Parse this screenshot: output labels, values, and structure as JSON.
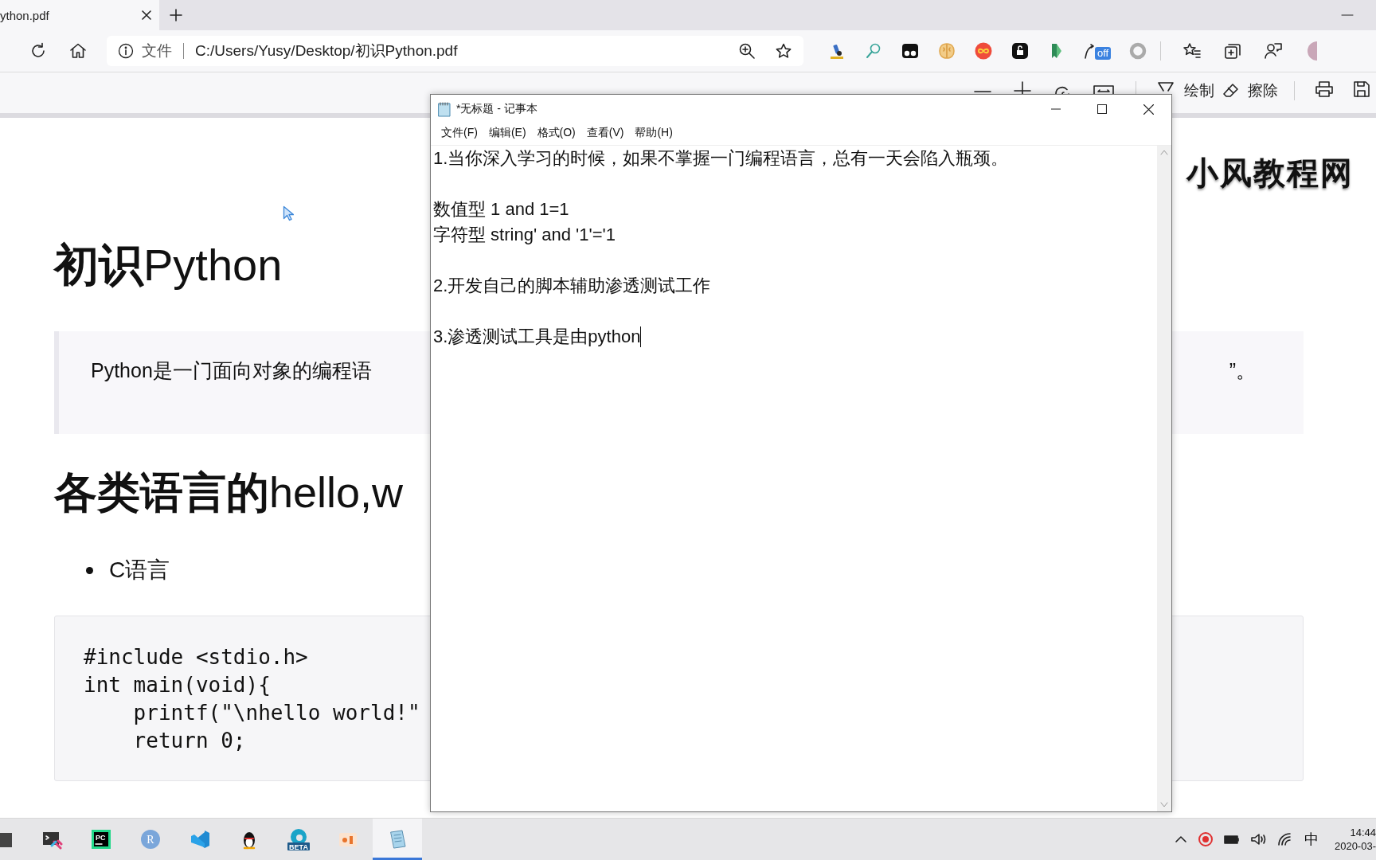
{
  "browser": {
    "tab": {
      "title": "ython.pdf",
      "selected": true
    },
    "address": {
      "label": "文件",
      "url": "C:/Users/Yusy/Desktop/初识Python.pdf"
    },
    "extensions": [
      {
        "kind": "microscope"
      },
      {
        "kind": "magnifier"
      },
      {
        "kind": "eyes"
      },
      {
        "kind": "brain"
      },
      {
        "kind": "infinity"
      },
      {
        "kind": "lock"
      },
      {
        "kind": "bookmark"
      },
      {
        "kind": "translate",
        "badge": "off"
      },
      {
        "kind": "ring"
      }
    ]
  },
  "pdf_toolbar": {
    "draw": "绘制",
    "erase": "擦除"
  },
  "document": {
    "logo": "小风教程网",
    "title": "**初识**Python",
    "quote_left": "Python是一门面向对象的编程语",
    "quote_right": "”。",
    "heading": "**各类语言的**hello,w",
    "bullet": "C语言",
    "code": [
      "#include <stdio.h>",
      "int main(void){",
      "    printf(\"\\nhello world!\"",
      "    return 0;"
    ]
  },
  "notepad": {
    "title": "*无标题 - 记事本",
    "menu": [
      "文件(F)",
      "编辑(E)",
      "格式(O)",
      "查看(V)",
      "帮助(H)"
    ],
    "paragraphs": [
      [
        "1.当你深入学习的时候，如果不掌握一门编程语言，总有一天会陷入瓶颈。"
      ],
      [
        "数值型 1 and 1=1",
        "字符型 string' and '1'='1"
      ],
      [
        "2.开发自己的脚本辅助渗透测试工作"
      ],
      [
        "3.渗透测试工具是由python"
      ]
    ]
  },
  "taskbar": {
    "apps": [
      {
        "kind": "file",
        "selected": false
      },
      {
        "kind": "terminal",
        "selected": false
      },
      {
        "kind": "letter-tile",
        "label": "PC",
        "selected": false
      },
      {
        "kind": "letter-circle",
        "label": "R",
        "selected": false
      },
      {
        "kind": "code-editor",
        "selected": false
      },
      {
        "kind": "penguin",
        "selected": false
      },
      {
        "kind": "browser-beta",
        "label": "BETA",
        "selected": false
      },
      {
        "kind": "slides",
        "selected": false
      },
      {
        "kind": "notepad",
        "selected": true
      }
    ],
    "ime": "中",
    "time": "14:44",
    "date": "2020-03-"
  }
}
